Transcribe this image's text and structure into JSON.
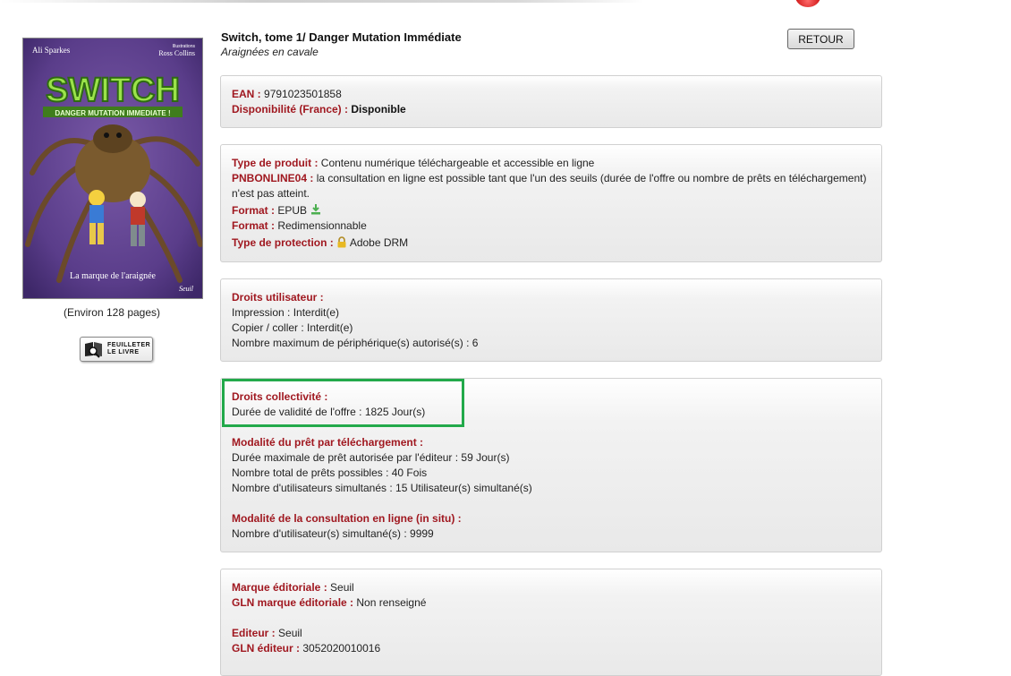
{
  "book": {
    "title": "Switch, tome 1/ Danger Mutation Immédiate",
    "subtitle": "Araignées en cavale",
    "pages": "(Environ 128 pages)",
    "cover": {
      "author": "Ali Sparkes",
      "illustrator_caption": "Illustrations",
      "illustrator": "Ross Collins",
      "logo": "SWITCH",
      "tagline": "DANGER MUTATION IMMEDIATE !",
      "bottom": "La marque de l'araignée",
      "publisher_mark": "Seuil"
    }
  },
  "buttons": {
    "retour": "RETOUR",
    "feuilleter_line1": "FEUILLETER",
    "feuilleter_line2": "LE LIVRE"
  },
  "panel1": {
    "ean_label": "EAN :",
    "ean_value": "9791023501858",
    "dispo_label": "Disponibilité (France) :",
    "dispo_value": "Disponible"
  },
  "panel2": {
    "type_label": "Type de produit :",
    "type_value": "Contenu numérique téléchargeable et accessible en ligne",
    "pnb_label": "PNBONLINE04 :",
    "pnb_value": "la consultation en ligne est possible tant que l'un des seuils (durée de l'offre ou nombre de prêts en téléchargement) n'est pas atteint.",
    "format1_label": "Format :",
    "format1_value": "EPUB",
    "format2_label": "Format :",
    "format2_value": "Redimensionnable",
    "protection_label": "Type de protection :",
    "protection_value": "Adobe DRM"
  },
  "panel3": {
    "heading": "Droits utilisateur :",
    "line1": "Impression : Interdit(e)",
    "line2": "Copier / coller : Interdit(e)",
    "line3": "Nombre maximum de périphérique(s) autorisé(s) : 6"
  },
  "panel4": {
    "coll_heading": "Droits collectivité :",
    "coll_line1": "Durée de validité de l'offre : 1825 Jour(s)",
    "pret_heading": "Modalité du prêt par téléchargement :",
    "pret_line1": "Durée maximale de prêt autorisée par l'éditeur : 59 Jour(s)",
    "pret_line2": "Nombre total de prêts possibles : 40 Fois",
    "pret_line3": "Nombre d'utilisateurs simultanés : 15 Utilisateur(s) simultané(s)",
    "insitu_heading": "Modalité de la consultation en ligne (in situ) :",
    "insitu_line1": "Nombre d'utilisateur(s) simultané(s) : 9999"
  },
  "panel5": {
    "marque_label": "Marque éditoriale :",
    "marque_value": "Seuil",
    "glnmarque_label": "GLN marque éditoriale :",
    "glnmarque_value": "Non renseigné",
    "editeur_label": "Editeur :",
    "editeur_value": "Seuil",
    "glnediteur_label": "GLN éditeur :",
    "glnediteur_value": "3052020010016"
  },
  "colors": {
    "label_red": "#a01820",
    "highlight_green": "#22a94a",
    "cover_purple": "#5a3d8a"
  }
}
